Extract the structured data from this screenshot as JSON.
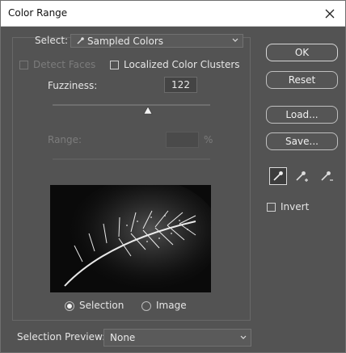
{
  "window": {
    "title": "Color Range"
  },
  "select": {
    "label": "Select:",
    "value": "Sampled Colors"
  },
  "detect_faces": {
    "label": "Detect Faces",
    "checked": false,
    "enabled": false
  },
  "localized_clusters": {
    "label": "Localized Color Clusters",
    "checked": false
  },
  "fuzziness": {
    "label": "Fuzziness:",
    "value": "122"
  },
  "range": {
    "label": "Range:",
    "value": "",
    "unit": "%",
    "enabled": false
  },
  "buttons": {
    "ok": "OK",
    "reset": "Reset",
    "load": "Load...",
    "save": "Save..."
  },
  "eyedroppers": [
    "eyedropper-tool",
    "add-to-sample-eyedropper",
    "subtract-from-sample-eyedropper"
  ],
  "invert": {
    "label": "Invert",
    "checked": false
  },
  "view_mode": {
    "selection_label": "Selection",
    "image_label": "Image",
    "selected": "Selection"
  },
  "selection_preview": {
    "label": "Selection Preview:",
    "value": "None"
  }
}
